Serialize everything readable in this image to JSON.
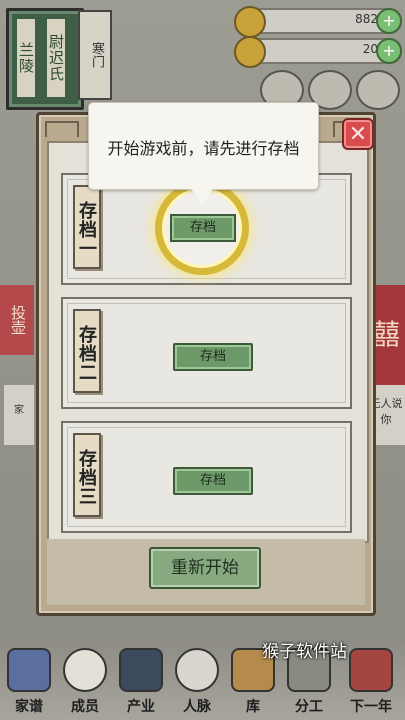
{
  "hud": {
    "book_left_title": "兰陵",
    "book_right_title": "尉迟氏",
    "book_side_title": "寒门",
    "resource1_value": "882",
    "resource2_value": "20"
  },
  "background": {
    "left_banner": "投壶",
    "right_badge": "囍",
    "right_card_text": "无人说你",
    "left_card_text": "家"
  },
  "tooltip": {
    "text": "开始游戏前，请先进行存档"
  },
  "modal": {
    "slots": [
      {
        "label": "存档一",
        "button": "存档"
      },
      {
        "label": "存档二",
        "button": "存档"
      },
      {
        "label": "存档三",
        "button": "存档"
      }
    ],
    "restart_label": "重新开始",
    "close_glyph": "✕"
  },
  "bottom_nav": [
    {
      "label": "家谱",
      "icon": "scroll-icon"
    },
    {
      "label": "成员",
      "icon": "person-icon"
    },
    {
      "label": "产业",
      "icon": "building-icon"
    },
    {
      "label": "人脉",
      "icon": "network-icon"
    },
    {
      "label": "库",
      "icon": "storage-icon"
    },
    {
      "label": "分工",
      "icon": "work-icon"
    },
    {
      "label": "下一年",
      "icon": "next-year-icon"
    }
  ],
  "watermark": "猴子软件站",
  "colors": {
    "accent_green": "#6e9a6a",
    "close_red": "#d84c4c",
    "highlight_gold": "#d6b93a"
  }
}
